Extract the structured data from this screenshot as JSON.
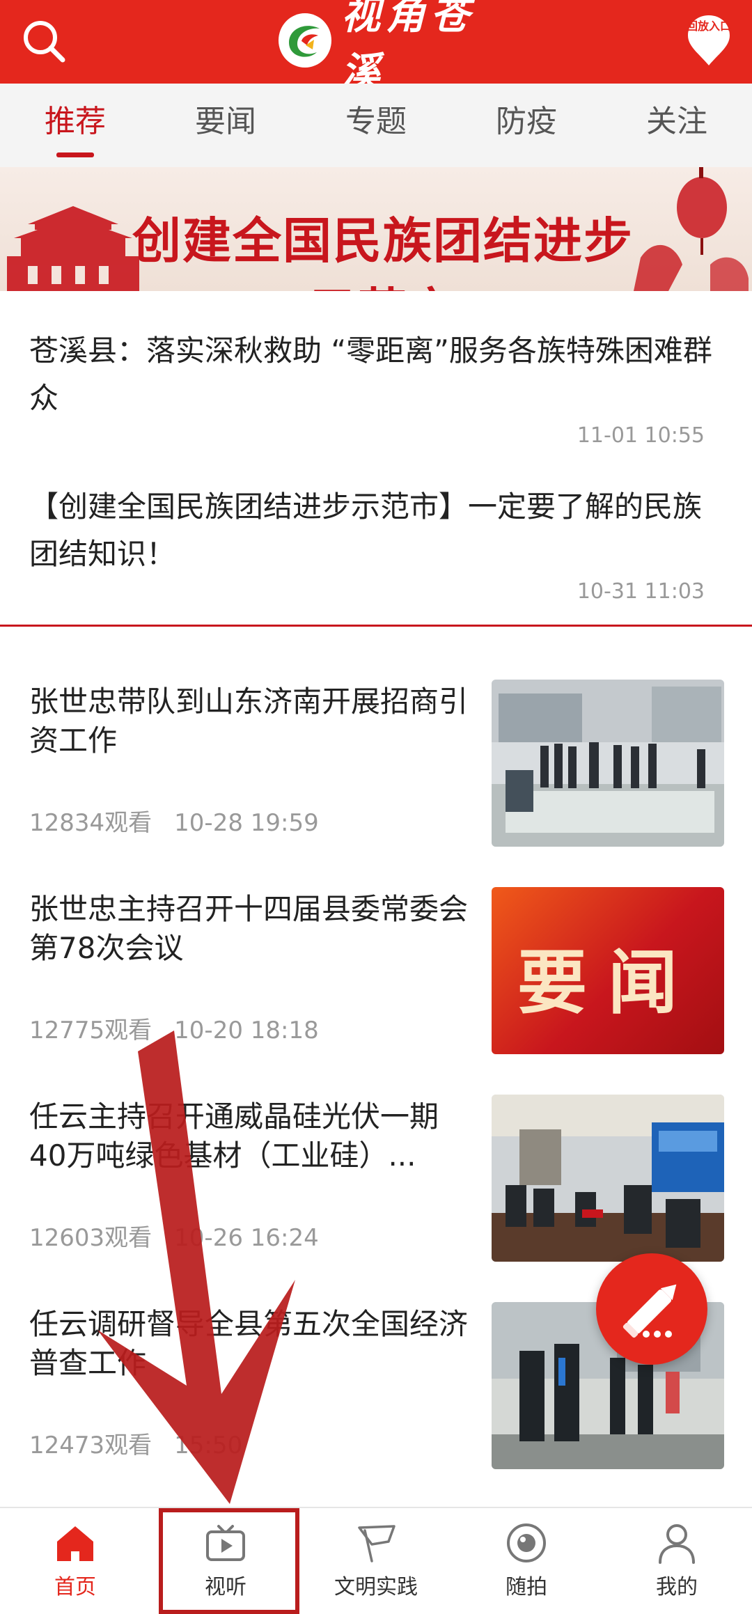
{
  "header": {
    "logo_text": "视角苍溪",
    "replay_label": "回放入口"
  },
  "tabs": [
    {
      "label": "推荐",
      "active": true
    },
    {
      "label": "要闻",
      "active": false
    },
    {
      "label": "专题",
      "active": false
    },
    {
      "label": "防疫",
      "active": false
    },
    {
      "label": "关注",
      "active": false
    }
  ],
  "banner": {
    "text": "创建全国民族团结进步示范市"
  },
  "top_news": [
    {
      "title": "苍溪县：落实深秋救助 “零距离”服务各族特殊困难群众",
      "time": "11-01 10:55"
    },
    {
      "title": "【创建全国民族团结进步示范市】一定要了解的民族团结知识！",
      "time": "10-31 11:03"
    }
  ],
  "news": [
    {
      "title": "张世忠带队到山东济南开展招商引资工作",
      "views": "12834观看",
      "time": "10-28 19:59",
      "thumb_text": ""
    },
    {
      "title": "张世忠主持召开十四届县委常委会第78次会议",
      "views": "12775观看",
      "time": "10-20 18:18",
      "thumb_text": "要闻"
    },
    {
      "title": "任云主持召开通威晶硅光伏一期40万吨绿色基材（工业硅）...",
      "views": "12603观看",
      "time": "10-26 16:24",
      "thumb_text": ""
    },
    {
      "title": "任云调研督导全县第五次全国经济普查工作",
      "views": "12473观看",
      "time": "15:50",
      "thumb_text": ""
    }
  ],
  "bottom_nav": [
    {
      "label": "首页",
      "icon": "home-icon",
      "active": true
    },
    {
      "label": "视听",
      "icon": "tv-icon",
      "active": false
    },
    {
      "label": "文明实践",
      "icon": "flag-icon",
      "active": false
    },
    {
      "label": "随拍",
      "icon": "camera-lens-icon",
      "active": false
    },
    {
      "label": "我的",
      "icon": "user-icon",
      "active": false
    }
  ],
  "colors": {
    "brand_red": "#e4271d",
    "dark_red": "#c8161d"
  }
}
